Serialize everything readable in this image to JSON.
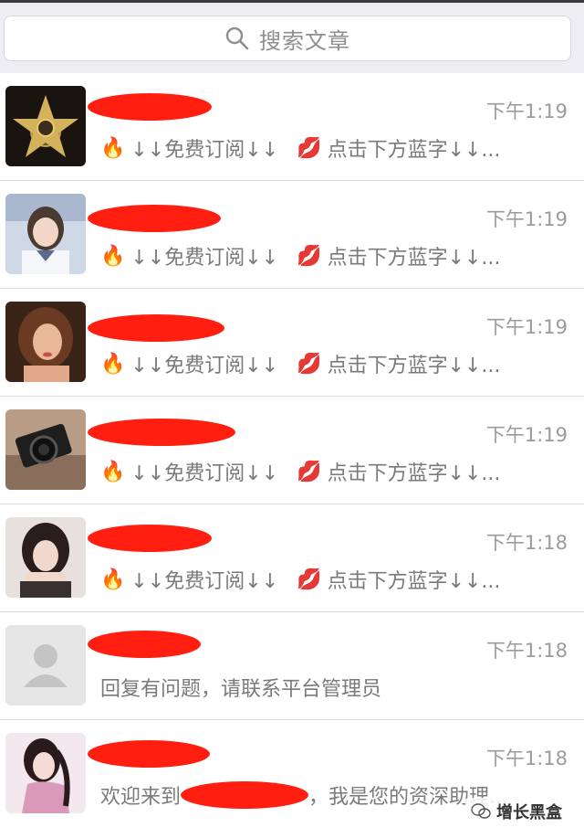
{
  "search": {
    "placeholder": "搜索文章"
  },
  "rows": [
    {
      "time": "下午1:19",
      "preview": {
        "emoji1": "🔥",
        "text1": "↓↓免费订阅↓↓",
        "emoji2": "💋",
        "text2": "点击下方蓝字↓↓..."
      },
      "avatar": "star-film-avatar"
    },
    {
      "time": "下午1:19",
      "preview": {
        "emoji1": "🔥",
        "text1": "↓↓免费订阅↓↓",
        "emoji2": "💋",
        "text2": "点击下方蓝字↓↓..."
      },
      "avatar": "girl-photo-avatar"
    },
    {
      "time": "下午1:19",
      "preview": {
        "emoji1": "🔥",
        "text1": "↓↓免费订阅↓↓",
        "emoji2": "💋",
        "text2": "点击下方蓝字↓↓..."
      },
      "avatar": "woman-portrait-avatar"
    },
    {
      "time": "下午1:19",
      "preview": {
        "emoji1": "🔥",
        "text1": "↓↓免费订阅↓↓",
        "emoji2": "💋",
        "text2": "点击下方蓝字↓↓..."
      },
      "avatar": "camera-avatar"
    },
    {
      "time": "下午1:18",
      "preview": {
        "emoji1": "🔥",
        "text1": "↓↓免费订阅↓↓",
        "emoji2": "💋",
        "text2": "点击下方蓝字↓↓..."
      },
      "avatar": "girl-hands-avatar"
    },
    {
      "time": "下午1:18",
      "preview": {
        "text": "回复有问题，请联系平台管理员"
      },
      "avatar": "default-person-avatar"
    },
    {
      "time": "下午1:18",
      "preview": {
        "text1": "欢迎来到",
        "text2": "，我是您的资深助理..."
      },
      "avatar": "painted-woman-avatar"
    }
  ],
  "watermark": {
    "text": "增长黑盒"
  },
  "colors": {
    "redaction": "#ff1e10",
    "time": "#9b9b9b",
    "preview": "#7a7a7a"
  }
}
